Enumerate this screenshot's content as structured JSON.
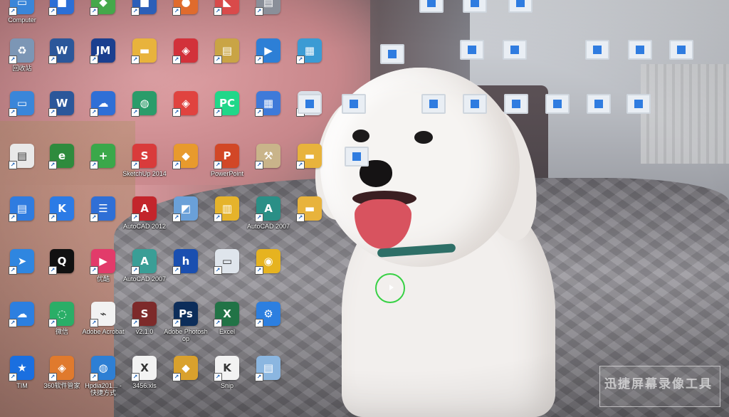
{
  "desktop": {
    "icons": [
      {
        "id": "computer",
        "label": "Computer",
        "icon": "computer-icon",
        "color": "#3a86d9",
        "glyph": "▭"
      },
      {
        "id": "top2",
        "label": "",
        "icon": "app-icon",
        "color": "#2b6fd6",
        "glyph": "■"
      },
      {
        "id": "top3",
        "label": "",
        "icon": "app-icon",
        "color": "#45a84a",
        "glyph": "◆"
      },
      {
        "id": "top4",
        "label": "",
        "icon": "app-icon",
        "color": "#2c5fb8",
        "glyph": "■"
      },
      {
        "id": "top5",
        "label": "",
        "icon": "app-icon",
        "color": "#e06b2d",
        "glyph": "●"
      },
      {
        "id": "top6",
        "label": "",
        "icon": "app-icon",
        "color": "#d94a4a",
        "glyph": "◣"
      },
      {
        "id": "top7",
        "label": "",
        "icon": "app-icon",
        "color": "#8a8f99",
        "glyph": "▤"
      },
      {
        "id": "recycle",
        "label": "回收站",
        "icon": "recycle-bin-icon",
        "color": "#7c96b5",
        "glyph": "♻"
      },
      {
        "id": "word1",
        "label": "",
        "icon": "word-doc-icon",
        "color": "#2b579a",
        "glyph": "W"
      },
      {
        "id": "jmi",
        "label": "",
        "icon": "jm-icon",
        "color": "#1b3f8f",
        "glyph": "JM"
      },
      {
        "id": "folder1",
        "label": "",
        "icon": "folder-icon",
        "color": "#e8b33c",
        "glyph": "▬"
      },
      {
        "id": "app-red",
        "label": "",
        "icon": "app-icon",
        "color": "#d2313a",
        "glyph": "◈"
      },
      {
        "id": "doc-y",
        "label": "",
        "icon": "document-icon",
        "color": "#c9a445",
        "glyph": "▤"
      },
      {
        "id": "video",
        "label": "",
        "icon": "video-recorder-icon",
        "color": "#2d7fd6",
        "glyph": "▶"
      },
      {
        "id": "photo",
        "label": "",
        "icon": "image-icon",
        "color": "#3b9bd4",
        "glyph": "▦"
      },
      {
        "id": "pc",
        "label": "",
        "icon": "computer-icon",
        "color": "#3a86d9",
        "glyph": "▭"
      },
      {
        "id": "word2",
        "label": "",
        "icon": "word-doc-icon",
        "color": "#2b579a",
        "glyph": "W"
      },
      {
        "id": "baidu",
        "label": "",
        "icon": "cloud-icon",
        "color": "#2f6fd6",
        "glyph": "☁"
      },
      {
        "id": "globe",
        "label": "",
        "icon": "globe-icon",
        "color": "#2a9c6a",
        "glyph": "◍"
      },
      {
        "id": "app-r2",
        "label": "",
        "icon": "app-icon",
        "color": "#e0433f",
        "glyph": "◈"
      },
      {
        "id": "pycharm",
        "label": "",
        "icon": "pycharm-icon",
        "color": "#21d789",
        "glyph": "PC"
      },
      {
        "id": "office",
        "label": "",
        "icon": "app-icon",
        "color": "#3f7ad9",
        "glyph": "▦"
      },
      {
        "id": "video2",
        "label": "",
        "icon": "video-icon",
        "color": "#d9e0e8",
        "glyph": "▭"
      },
      {
        "id": "doc-white",
        "label": "",
        "icon": "document-icon",
        "color": "#e9e9e9",
        "glyph": "▤"
      },
      {
        "id": "ie",
        "label": "",
        "icon": "ie-browser-icon",
        "color": "#2e8b3d",
        "glyph": "e"
      },
      {
        "id": "app-green",
        "label": "",
        "icon": "app-icon",
        "color": "#3aa84a",
        "glyph": "+"
      },
      {
        "id": "sketchup",
        "label": "SketchUp 2014",
        "icon": "sketchup-icon",
        "color": "#d93b3b",
        "glyph": "S"
      },
      {
        "id": "rhino",
        "label": "",
        "icon": "app-icon",
        "color": "#e89a2d",
        "glyph": "◆"
      },
      {
        "id": "powerpoint",
        "label": "PowerPoint",
        "icon": "powerpoint-icon",
        "color": "#d24726",
        "glyph": "P"
      },
      {
        "id": "sql",
        "label": "",
        "icon": "sql-server-icon",
        "color": "#c9b48a",
        "glyph": "⚒"
      },
      {
        "id": "folder2",
        "label": "",
        "icon": "folder-icon",
        "color": "#e8b33c",
        "glyph": "▬"
      },
      {
        "id": "notes",
        "label": "",
        "icon": "app-icon",
        "color": "#2f7ce0",
        "glyph": "▤"
      },
      {
        "id": "kugou",
        "label": "",
        "icon": "kugou-icon",
        "color": "#2b7be6",
        "glyph": "K"
      },
      {
        "id": "storm",
        "label": "",
        "icon": "app-icon",
        "color": "#2f6fd6",
        "glyph": "☰"
      },
      {
        "id": "autocad2012",
        "label": "AutoCAD 2012",
        "icon": "autocad-icon",
        "color": "#c3252b",
        "glyph": "A"
      },
      {
        "id": "cad-mini",
        "label": "",
        "icon": "app-icon",
        "color": "#6aa0d8",
        "glyph": "◩"
      },
      {
        "id": "glodon",
        "label": "",
        "icon": "app-icon",
        "color": "#e5b32b",
        "glyph": "▥"
      },
      {
        "id": "autocad2007",
        "label": "AutoCAD 2007",
        "icon": "autocad-icon",
        "color": "#2a8f86",
        "glyph": "A"
      },
      {
        "id": "folder3",
        "label": "",
        "icon": "folder-icon",
        "color": "#e8b33c",
        "glyph": "▬"
      },
      {
        "id": "feishu",
        "label": "",
        "icon": "app-icon",
        "color": "#2f86e0",
        "glyph": "➤"
      },
      {
        "id": "qq",
        "label": "",
        "icon": "qq-icon",
        "color": "#111111",
        "glyph": "Q"
      },
      {
        "id": "youku",
        "label": "优酷",
        "icon": "youku-icon",
        "color": "#e23b6a",
        "glyph": "▶"
      },
      {
        "id": "autocad2007b",
        "label": "AutoCAD 2007",
        "icon": "autocad-icon",
        "color": "#3a9e96",
        "glyph": "A"
      },
      {
        "id": "hp",
        "label": "",
        "icon": "app-icon",
        "color": "#1a4fb0",
        "glyph": "h"
      },
      {
        "id": "remote",
        "label": "",
        "icon": "remote-desktop-icon",
        "color": "#dfe5ec",
        "glyph": "▭"
      },
      {
        "id": "chrome",
        "label": "",
        "icon": "chrome-icon",
        "color": "#e6b320",
        "glyph": "◉"
      },
      {
        "id": "cloudnote",
        "label": "",
        "icon": "cloud-icon",
        "color": "#2c7fe0",
        "glyph": "☁"
      },
      {
        "id": "wechat",
        "label": "微信",
        "icon": "wechat-icon",
        "color": "#2aae67",
        "glyph": "◌"
      },
      {
        "id": "acrobat",
        "label": "Adobe Acrobat",
        "icon": "acrobat-icon",
        "color": "#f2f2f2",
        "glyph": "⌁"
      },
      {
        "id": "s-app",
        "label": "v2.1.0",
        "icon": "app-icon",
        "color": "#7d2a2a",
        "glyph": "S"
      },
      {
        "id": "photoshop",
        "label": "Adobe Photoshop",
        "icon": "photoshop-icon",
        "color": "#0c2d5a",
        "glyph": "Ps"
      },
      {
        "id": "excel",
        "label": "Excel",
        "icon": "excel-icon",
        "color": "#217346",
        "glyph": "X"
      },
      {
        "id": "settings",
        "label": "",
        "icon": "gear-icon",
        "color": "#2c7fe0",
        "glyph": "⚙"
      },
      {
        "id": "tim",
        "label": "TIM",
        "icon": "tim-icon",
        "color": "#1a6fe0",
        "glyph": "★"
      },
      {
        "id": "360",
        "label": "360软件管家",
        "icon": "app-icon",
        "color": "#e07a2d",
        "glyph": "◈"
      },
      {
        "id": "hpdia",
        "label": "Hpdia201... - 快捷方式",
        "icon": "globe-icon",
        "color": "#2e7fd4",
        "glyph": "◍"
      },
      {
        "id": "xls",
        "label": "3456.xls",
        "icon": "excel-file-icon",
        "color": "#f2f2f2",
        "glyph": "X"
      },
      {
        "id": "multi",
        "label": "",
        "icon": "app-icon",
        "color": "#d9a12d",
        "glyph": "◆"
      },
      {
        "id": "snip",
        "label": "Snip",
        "icon": "snip-icon",
        "color": "#f2f2f2",
        "glyph": "K"
      },
      {
        "id": "notepad",
        "label": "",
        "icon": "notepad-icon",
        "color": "#8bb6e0",
        "glyph": "▤"
      }
    ],
    "exe_files": [
      {
        "id": "exe1",
        "label": ""
      },
      {
        "id": "exe2",
        "label": ""
      },
      {
        "id": "exe3",
        "label": ""
      },
      {
        "id": "exe4",
        "label": ""
      },
      {
        "id": "exe5",
        "label": ""
      },
      {
        "id": "exe6",
        "label": ""
      },
      {
        "id": "exe7",
        "label": ""
      },
      {
        "id": "exe8",
        "label": ""
      },
      {
        "id": "exe9",
        "label": ""
      },
      {
        "id": "exe10",
        "label": ""
      },
      {
        "id": "exe11",
        "label": ""
      },
      {
        "id": "exe12",
        "label": ""
      },
      {
        "id": "exe13",
        "label": ""
      },
      {
        "id": "exe14",
        "label": ""
      },
      {
        "id": "exe15",
        "label": ""
      },
      {
        "id": "exe16",
        "label": ""
      },
      {
        "id": "exe17",
        "label": ""
      },
      {
        "id": "exe18",
        "label": ""
      }
    ]
  },
  "watermark": {
    "text": "迅捷屏幕录像工具",
    "sub": ""
  }
}
